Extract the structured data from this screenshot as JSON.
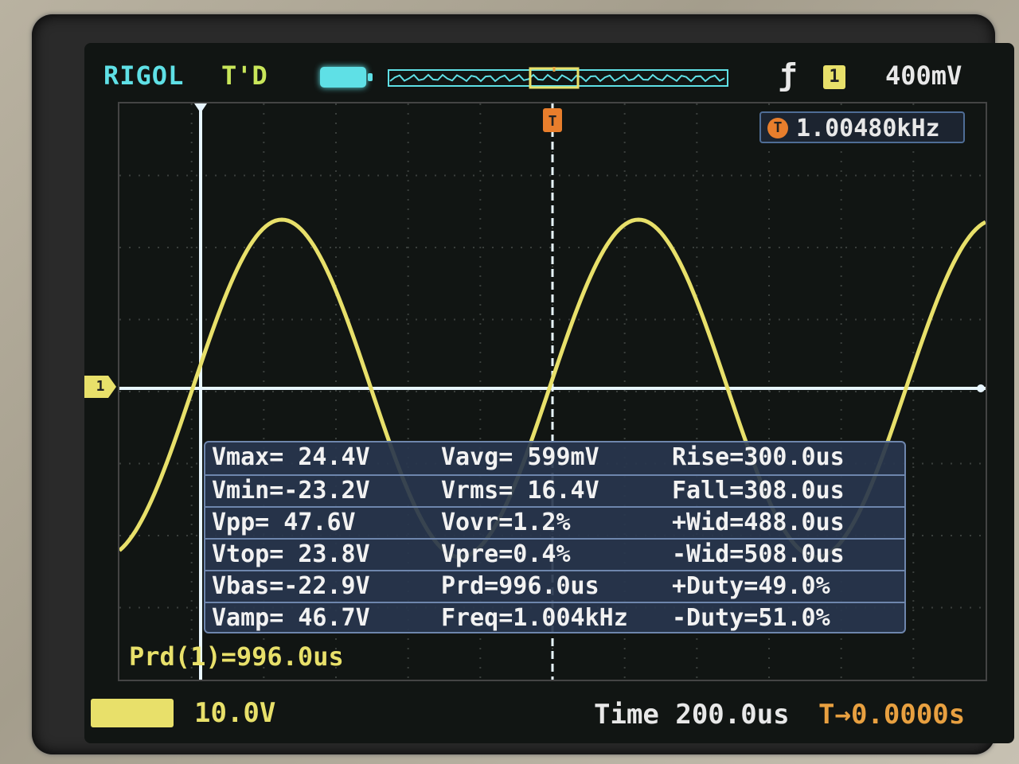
{
  "header": {
    "brand": "RIGOL",
    "run_status": "T'D",
    "trigger_level": "400mV",
    "channel_badge": "1"
  },
  "frequency_counter": {
    "badge": "T",
    "value": "1.00480kHz"
  },
  "channel_marker": "1",
  "measurements": {
    "rows": [
      [
        "Vmax= 24.4V",
        "Vavg= 599mV",
        "Rise=300.0us"
      ],
      [
        "Vmin=-23.2V",
        "Vrms= 16.4V",
        "Fall=308.0us"
      ],
      [
        "Vpp= 47.6V",
        "Vovr=1.2%",
        "+Wid=488.0us"
      ],
      [
        "Vtop= 23.8V",
        "Vpre=0.4%",
        "-Wid=508.0us"
      ],
      [
        "Vbas=-22.9V",
        "Prd=996.0us",
        "+Duty=49.0%"
      ],
      [
        "Vamp= 46.7V",
        "Freq=1.004kHz",
        "-Duty=51.0%"
      ]
    ]
  },
  "period_readout": "Prd(1)=996.0us",
  "footer": {
    "channel_scale": "10.0V",
    "timebase": "Time 200.0us",
    "time_offset": "T→0.0000s"
  },
  "colors": {
    "trace": "#e8e06a",
    "cursor": "#e8f6ff",
    "trigger": "#e87e2c",
    "panel": "#28364e"
  },
  "icons": {
    "battery": "battery-icon",
    "trigger_edge": "rising-edge-icon",
    "memory_depth": "memory-waveform-icon"
  }
}
